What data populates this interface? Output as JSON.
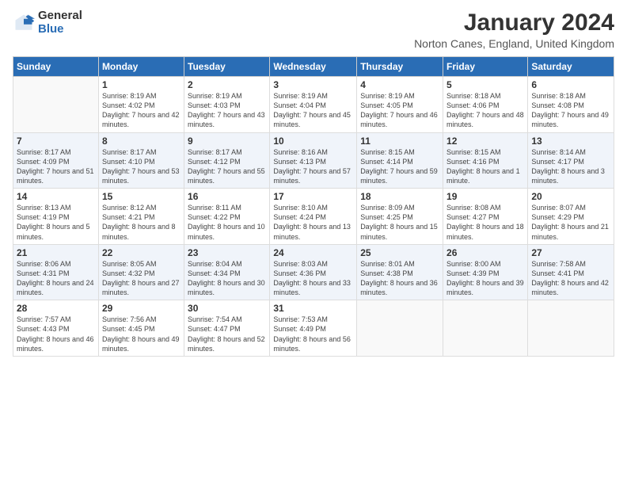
{
  "logo": {
    "general": "General",
    "blue": "Blue"
  },
  "title": "January 2024",
  "subtitle": "Norton Canes, England, United Kingdom",
  "headers": [
    "Sunday",
    "Monday",
    "Tuesday",
    "Wednesday",
    "Thursday",
    "Friday",
    "Saturday"
  ],
  "weeks": [
    [
      {
        "day": "",
        "sunrise": "",
        "sunset": "",
        "daylight": ""
      },
      {
        "day": "1",
        "sunrise": "Sunrise: 8:19 AM",
        "sunset": "Sunset: 4:02 PM",
        "daylight": "Daylight: 7 hours and 42 minutes."
      },
      {
        "day": "2",
        "sunrise": "Sunrise: 8:19 AM",
        "sunset": "Sunset: 4:03 PM",
        "daylight": "Daylight: 7 hours and 43 minutes."
      },
      {
        "day": "3",
        "sunrise": "Sunrise: 8:19 AM",
        "sunset": "Sunset: 4:04 PM",
        "daylight": "Daylight: 7 hours and 45 minutes."
      },
      {
        "day": "4",
        "sunrise": "Sunrise: 8:19 AM",
        "sunset": "Sunset: 4:05 PM",
        "daylight": "Daylight: 7 hours and 46 minutes."
      },
      {
        "day": "5",
        "sunrise": "Sunrise: 8:18 AM",
        "sunset": "Sunset: 4:06 PM",
        "daylight": "Daylight: 7 hours and 48 minutes."
      },
      {
        "day": "6",
        "sunrise": "Sunrise: 8:18 AM",
        "sunset": "Sunset: 4:08 PM",
        "daylight": "Daylight: 7 hours and 49 minutes."
      }
    ],
    [
      {
        "day": "7",
        "sunrise": "Sunrise: 8:17 AM",
        "sunset": "Sunset: 4:09 PM",
        "daylight": "Daylight: 7 hours and 51 minutes."
      },
      {
        "day": "8",
        "sunrise": "Sunrise: 8:17 AM",
        "sunset": "Sunset: 4:10 PM",
        "daylight": "Daylight: 7 hours and 53 minutes."
      },
      {
        "day": "9",
        "sunrise": "Sunrise: 8:17 AM",
        "sunset": "Sunset: 4:12 PM",
        "daylight": "Daylight: 7 hours and 55 minutes."
      },
      {
        "day": "10",
        "sunrise": "Sunrise: 8:16 AM",
        "sunset": "Sunset: 4:13 PM",
        "daylight": "Daylight: 7 hours and 57 minutes."
      },
      {
        "day": "11",
        "sunrise": "Sunrise: 8:15 AM",
        "sunset": "Sunset: 4:14 PM",
        "daylight": "Daylight: 7 hours and 59 minutes."
      },
      {
        "day": "12",
        "sunrise": "Sunrise: 8:15 AM",
        "sunset": "Sunset: 4:16 PM",
        "daylight": "Daylight: 8 hours and 1 minute."
      },
      {
        "day": "13",
        "sunrise": "Sunrise: 8:14 AM",
        "sunset": "Sunset: 4:17 PM",
        "daylight": "Daylight: 8 hours and 3 minutes."
      }
    ],
    [
      {
        "day": "14",
        "sunrise": "Sunrise: 8:13 AM",
        "sunset": "Sunset: 4:19 PM",
        "daylight": "Daylight: 8 hours and 5 minutes."
      },
      {
        "day": "15",
        "sunrise": "Sunrise: 8:12 AM",
        "sunset": "Sunset: 4:21 PM",
        "daylight": "Daylight: 8 hours and 8 minutes."
      },
      {
        "day": "16",
        "sunrise": "Sunrise: 8:11 AM",
        "sunset": "Sunset: 4:22 PM",
        "daylight": "Daylight: 8 hours and 10 minutes."
      },
      {
        "day": "17",
        "sunrise": "Sunrise: 8:10 AM",
        "sunset": "Sunset: 4:24 PM",
        "daylight": "Daylight: 8 hours and 13 minutes."
      },
      {
        "day": "18",
        "sunrise": "Sunrise: 8:09 AM",
        "sunset": "Sunset: 4:25 PM",
        "daylight": "Daylight: 8 hours and 15 minutes."
      },
      {
        "day": "19",
        "sunrise": "Sunrise: 8:08 AM",
        "sunset": "Sunset: 4:27 PM",
        "daylight": "Daylight: 8 hours and 18 minutes."
      },
      {
        "day": "20",
        "sunrise": "Sunrise: 8:07 AM",
        "sunset": "Sunset: 4:29 PM",
        "daylight": "Daylight: 8 hours and 21 minutes."
      }
    ],
    [
      {
        "day": "21",
        "sunrise": "Sunrise: 8:06 AM",
        "sunset": "Sunset: 4:31 PM",
        "daylight": "Daylight: 8 hours and 24 minutes."
      },
      {
        "day": "22",
        "sunrise": "Sunrise: 8:05 AM",
        "sunset": "Sunset: 4:32 PM",
        "daylight": "Daylight: 8 hours and 27 minutes."
      },
      {
        "day": "23",
        "sunrise": "Sunrise: 8:04 AM",
        "sunset": "Sunset: 4:34 PM",
        "daylight": "Daylight: 8 hours and 30 minutes."
      },
      {
        "day": "24",
        "sunrise": "Sunrise: 8:03 AM",
        "sunset": "Sunset: 4:36 PM",
        "daylight": "Daylight: 8 hours and 33 minutes."
      },
      {
        "day": "25",
        "sunrise": "Sunrise: 8:01 AM",
        "sunset": "Sunset: 4:38 PM",
        "daylight": "Daylight: 8 hours and 36 minutes."
      },
      {
        "day": "26",
        "sunrise": "Sunrise: 8:00 AM",
        "sunset": "Sunset: 4:39 PM",
        "daylight": "Daylight: 8 hours and 39 minutes."
      },
      {
        "day": "27",
        "sunrise": "Sunrise: 7:58 AM",
        "sunset": "Sunset: 4:41 PM",
        "daylight": "Daylight: 8 hours and 42 minutes."
      }
    ],
    [
      {
        "day": "28",
        "sunrise": "Sunrise: 7:57 AM",
        "sunset": "Sunset: 4:43 PM",
        "daylight": "Daylight: 8 hours and 46 minutes."
      },
      {
        "day": "29",
        "sunrise": "Sunrise: 7:56 AM",
        "sunset": "Sunset: 4:45 PM",
        "daylight": "Daylight: 8 hours and 49 minutes."
      },
      {
        "day": "30",
        "sunrise": "Sunrise: 7:54 AM",
        "sunset": "Sunset: 4:47 PM",
        "daylight": "Daylight: 8 hours and 52 minutes."
      },
      {
        "day": "31",
        "sunrise": "Sunrise: 7:53 AM",
        "sunset": "Sunset: 4:49 PM",
        "daylight": "Daylight: 8 hours and 56 minutes."
      },
      {
        "day": "",
        "sunrise": "",
        "sunset": "",
        "daylight": ""
      },
      {
        "day": "",
        "sunrise": "",
        "sunset": "",
        "daylight": ""
      },
      {
        "day": "",
        "sunrise": "",
        "sunset": "",
        "daylight": ""
      }
    ]
  ]
}
